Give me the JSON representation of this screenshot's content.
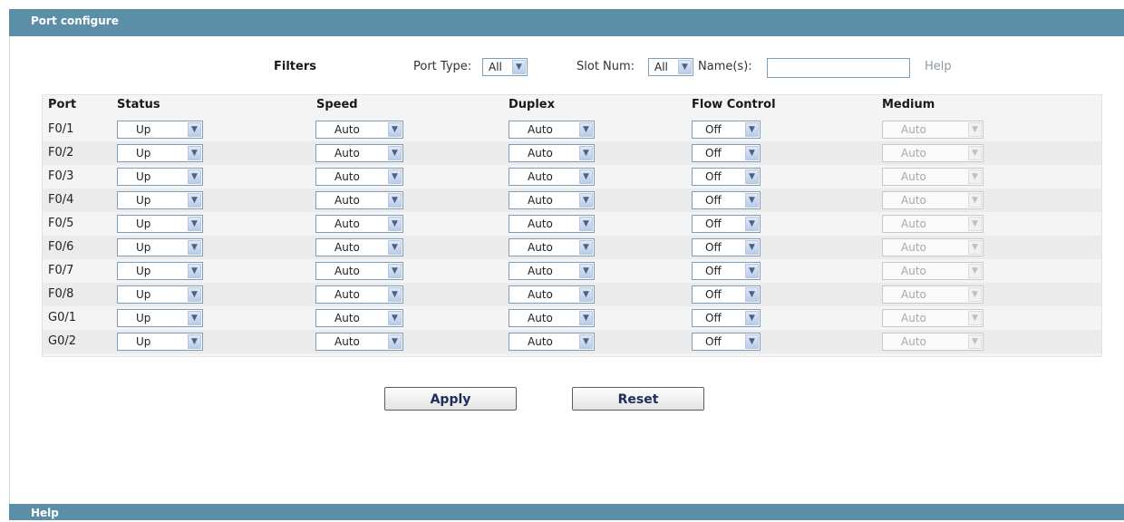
{
  "header": {
    "title": "Port configure"
  },
  "filters": {
    "label": "Filters",
    "port_type_label": "Port Type:",
    "port_type_value": "All",
    "slot_num_label": "Slot Num:",
    "slot_num_value": "All",
    "names_label": "Name(s):",
    "names_value": "",
    "help_link": "Help"
  },
  "table": {
    "columns": [
      "Port",
      "Status",
      "Speed",
      "Duplex",
      "Flow Control",
      "Medium"
    ],
    "rows": [
      {
        "port": "F0/1",
        "status": "Up",
        "speed": "Auto",
        "duplex": "Auto",
        "flow": "Off",
        "medium": "Auto"
      },
      {
        "port": "F0/2",
        "status": "Up",
        "speed": "Auto",
        "duplex": "Auto",
        "flow": "Off",
        "medium": "Auto"
      },
      {
        "port": "F0/3",
        "status": "Up",
        "speed": "Auto",
        "duplex": "Auto",
        "flow": "Off",
        "medium": "Auto"
      },
      {
        "port": "F0/4",
        "status": "Up",
        "speed": "Auto",
        "duplex": "Auto",
        "flow": "Off",
        "medium": "Auto"
      },
      {
        "port": "F0/5",
        "status": "Up",
        "speed": "Auto",
        "duplex": "Auto",
        "flow": "Off",
        "medium": "Auto"
      },
      {
        "port": "F0/6",
        "status": "Up",
        "speed": "Auto",
        "duplex": "Auto",
        "flow": "Off",
        "medium": "Auto"
      },
      {
        "port": "F0/7",
        "status": "Up",
        "speed": "Auto",
        "duplex": "Auto",
        "flow": "Off",
        "medium": "Auto"
      },
      {
        "port": "F0/8",
        "status": "Up",
        "speed": "Auto",
        "duplex": "Auto",
        "flow": "Off",
        "medium": "Auto"
      },
      {
        "port": "G0/1",
        "status": "Up",
        "speed": "Auto",
        "duplex": "Auto",
        "flow": "Off",
        "medium": "Auto"
      },
      {
        "port": "G0/2",
        "status": "Up",
        "speed": "Auto",
        "duplex": "Auto",
        "flow": "Off",
        "medium": "Auto"
      }
    ]
  },
  "buttons": {
    "apply": "Apply",
    "reset": "Reset"
  },
  "help_section": {
    "title": "Help"
  },
  "colors": {
    "header_bar": "#5b8fa8",
    "button_text": "#1f2d5a"
  },
  "icons": {
    "dropdown": "chevron-down-icon"
  }
}
